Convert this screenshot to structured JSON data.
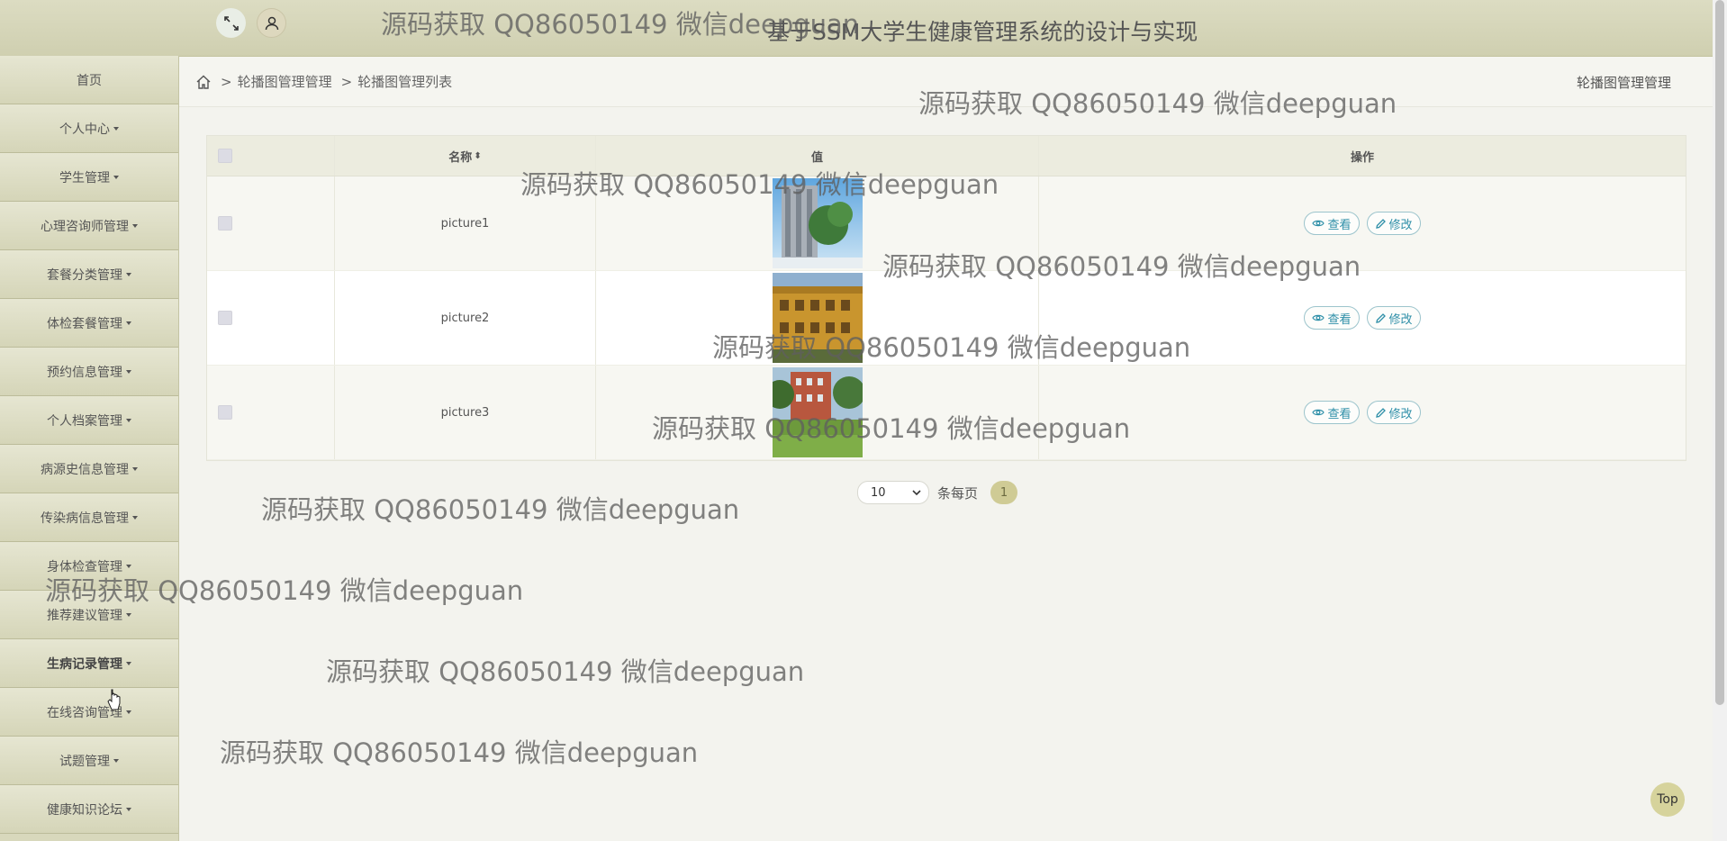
{
  "header": {
    "system_title": "基于SSM大学生健康管理系统的设计与实现",
    "fullscreen_icon": "expand-icon",
    "user_icon": "user-icon"
  },
  "sidebar": {
    "items": [
      {
        "label": "首页",
        "caret": false
      },
      {
        "label": "个人中心",
        "caret": true
      },
      {
        "label": "学生管理",
        "caret": true
      },
      {
        "label": "心理咨询师管理",
        "caret": true
      },
      {
        "label": "套餐分类管理",
        "caret": true
      },
      {
        "label": "体检套餐管理",
        "caret": true
      },
      {
        "label": "预约信息管理",
        "caret": true
      },
      {
        "label": "个人档案管理",
        "caret": true
      },
      {
        "label": "病源史信息管理",
        "caret": true
      },
      {
        "label": "传染病信息管理",
        "caret": true
      },
      {
        "label": "身体检查管理",
        "caret": true
      },
      {
        "label": "推荐建议管理",
        "caret": true
      },
      {
        "label": "生病记录管理",
        "caret": true
      },
      {
        "label": "在线咨询管理",
        "caret": true
      },
      {
        "label": "试题管理",
        "caret": true
      },
      {
        "label": "健康知识论坛",
        "caret": true
      }
    ]
  },
  "breadcrumb": {
    "home_icon": "home-icon",
    "level1": "轮播图管理管理",
    "level2": "轮播图管理列表",
    "separator": ">",
    "right_title": "轮播图管理管理"
  },
  "table": {
    "headers": {
      "name": "名称",
      "value": "值",
      "action": "操作"
    },
    "sort_icon": "sort-icon",
    "rows": [
      {
        "name": "picture1",
        "image": "building-photo"
      },
      {
        "name": "picture2",
        "image": "campus-building-photo"
      },
      {
        "name": "picture3",
        "image": "campus-lawn-photo"
      }
    ],
    "view_label": "查看",
    "edit_label": "修改"
  },
  "pager": {
    "page_size": "10",
    "per_page_label": "条每页",
    "current_page": "1"
  },
  "top_button": "Top",
  "watermark": "源码获取 QQ86050149 微信deepguan"
}
